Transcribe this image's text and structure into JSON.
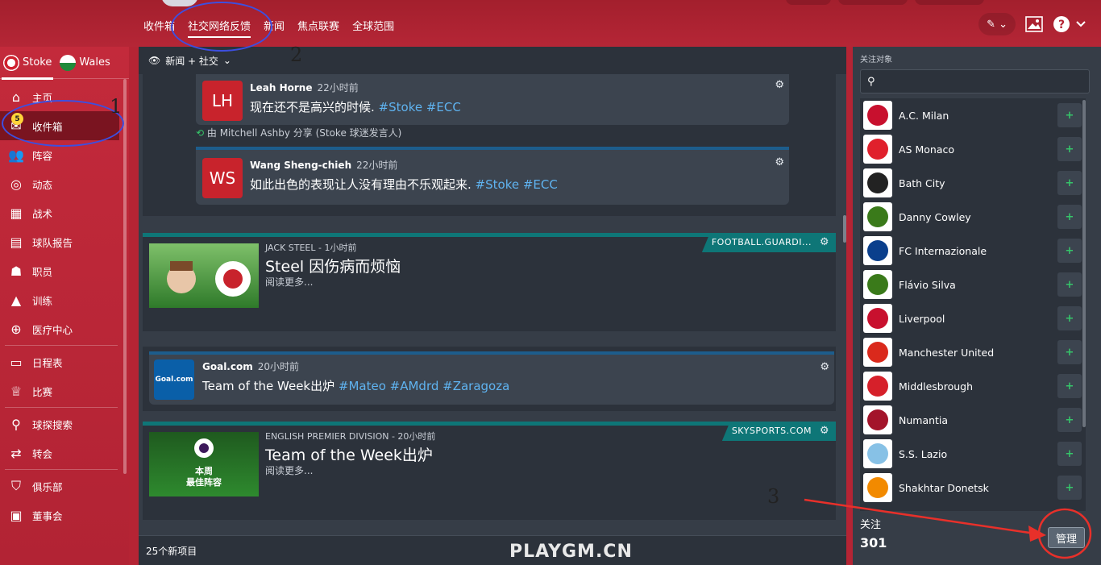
{
  "topnav": {
    "items": [
      "收件箱",
      "社交网络反馈",
      "新闻",
      "焦点联赛",
      "全球范围"
    ],
    "active_index": 1,
    "right_icons": [
      "pencil-icon",
      "image-icon",
      "help-icon"
    ]
  },
  "sidebar": {
    "team1": "Stoke",
    "team2": "Wales",
    "items": [
      "主页",
      "收件箱",
      "阵容",
      "动态",
      "战术",
      "球队报告",
      "职员",
      "训练",
      "医疗中心",
      "日程表",
      "比赛",
      "球探搜索",
      "转会",
      "俱乐部",
      "董事会"
    ],
    "inbox_count": "5",
    "active_index": 1
  },
  "filter": {
    "label": "新闻 + 社交"
  },
  "feed": {
    "tweet1": {
      "initials": "LH",
      "author": "Leah Horne",
      "time": "22小时前",
      "text": "现在还不是高兴的时候. ",
      "tags": "#Stoke #ECC"
    },
    "shared_line": "由 Mitchell Ashby 分享 (Stoke 球迷发言人)",
    "tweet2": {
      "initials": "WS",
      "author": "Wang Sheng-chieh",
      "time": "22小时前",
      "text": "如此出色的表现让人没有理由不乐观起来. ",
      "tags": "#Stoke #ECC"
    },
    "news1": {
      "source": "FOOTBALL.GUARDI...",
      "meta": "JACK STEEL  -  1小时前",
      "title": "Steel 因伤病而烦恼",
      "more": "阅读更多..."
    },
    "goal": {
      "logo": "Goal.com",
      "author": "Goal.com",
      "time": "20小时前",
      "text": "Team of the Week出炉 ",
      "tags": "#Mateo #AMdrd #Zaragoza"
    },
    "news2": {
      "source": "SKYSPORTS.COM",
      "meta": "ENGLISH PREMIER DIVISION  -  20小时前",
      "title": "Team of the Week出炉",
      "more": "阅读更多...",
      "thumb_line1": "本周",
      "thumb_line2": "最佳阵容"
    },
    "footer": "25个新项目"
  },
  "follow": {
    "label": "关注对象",
    "search_placeholder": "",
    "items": [
      {
        "name": "A.C. Milan",
        "color": "#c8102e"
      },
      {
        "name": "AS Monaco",
        "color": "#e0202c"
      },
      {
        "name": "Bath City",
        "color": "#222222"
      },
      {
        "name": "Danny Cowley",
        "color": "#3a7a1a"
      },
      {
        "name": "FC Internazionale",
        "color": "#0a3f8c"
      },
      {
        "name": "Flávio Silva",
        "color": "#3a7a1a"
      },
      {
        "name": "Liverpool",
        "color": "#c8102e"
      },
      {
        "name": "Manchester United",
        "color": "#da291c"
      },
      {
        "name": "Middlesbrough",
        "color": "#d6202a"
      },
      {
        "name": "Numantia",
        "color": "#a3142a"
      },
      {
        "name": "S.S. Lazio",
        "color": "#87c1e6"
      },
      {
        "name": "Shakhtar Donetsk",
        "color": "#f28a00"
      }
    ],
    "stats_label": "关注",
    "count": "301",
    "manage": "管理"
  },
  "annotations": [
    "1",
    "2",
    "3"
  ],
  "watermark": "PLAYGM.CN"
}
